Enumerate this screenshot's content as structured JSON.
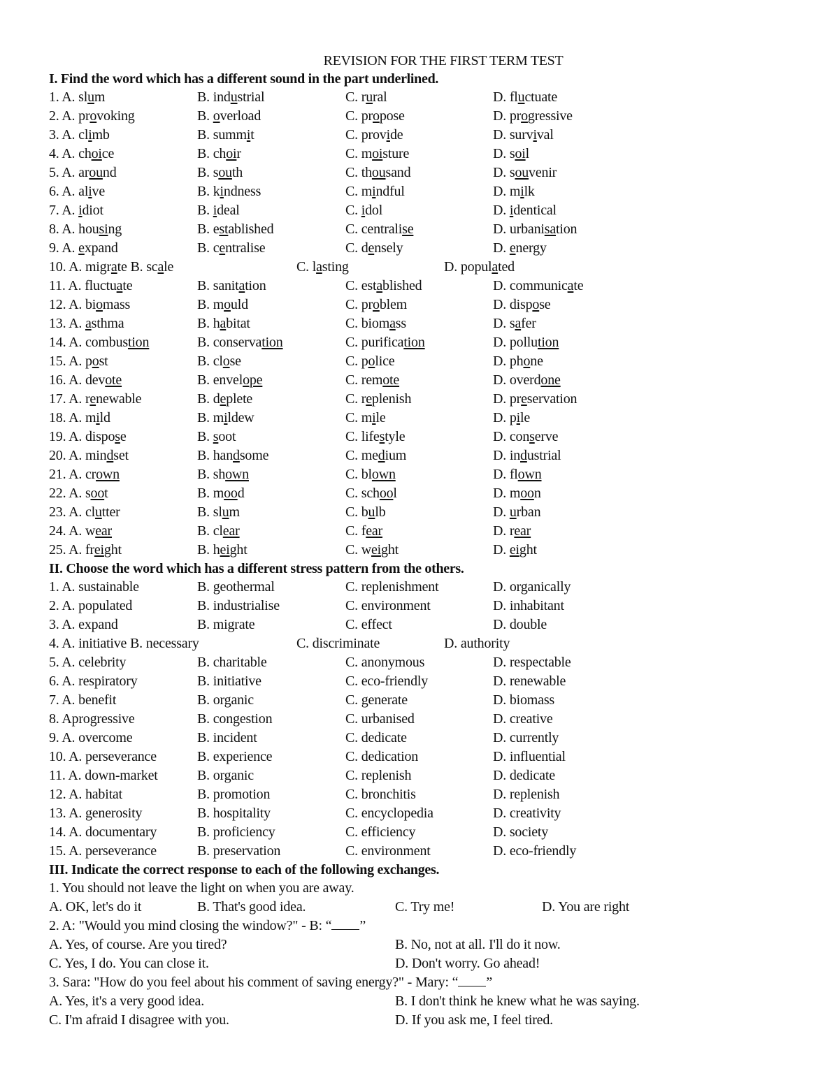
{
  "title": "REVISION FOR THE FIRST TERM TEST",
  "section1": {
    "heading": "I. Find the word which has a different sound in the part underlined.",
    "questions": [
      {
        "num": "1.",
        "options": [
          [
            "A. sl",
            "u",
            "m"
          ],
          [
            "B. ind",
            "u",
            "strial"
          ],
          [
            "C. r",
            "u",
            "ral"
          ],
          [
            "D. fl",
            "u",
            "ctuate"
          ]
        ]
      },
      {
        "num": "2.",
        "options": [
          [
            "A. pr",
            "o",
            "voking"
          ],
          [
            "B. ",
            "o",
            "verload"
          ],
          [
            "C. pr",
            "o",
            "pose"
          ],
          [
            "D. pr",
            "o",
            "gressive"
          ]
        ]
      },
      {
        "num": "3.",
        "options": [
          [
            "A. cl",
            "i",
            "mb"
          ],
          [
            "B. summ",
            "i",
            "t"
          ],
          [
            "C. prov",
            "i",
            "de"
          ],
          [
            "D. surv",
            "i",
            "val"
          ]
        ]
      },
      {
        "num": "4.",
        "options": [
          [
            "A. ch",
            "oi",
            "ce"
          ],
          [
            "B. ch",
            "oi",
            "r"
          ],
          [
            "C. m",
            "oi",
            "sture"
          ],
          [
            "D. s",
            "oi",
            "l"
          ]
        ]
      },
      {
        "num": "5.",
        "options": [
          [
            "A. ar",
            "ou",
            "nd"
          ],
          [
            "B. s",
            "ou",
            "th"
          ],
          [
            "C. th",
            "ou",
            "sand"
          ],
          [
            "D. s",
            "ou",
            "venir"
          ]
        ]
      },
      {
        "num": "6.",
        "options": [
          [
            "A. al",
            "i",
            "ve"
          ],
          [
            "B. k",
            "i",
            "ndness"
          ],
          [
            "C. m",
            "i",
            "ndful"
          ],
          [
            "D. m",
            "i",
            "lk"
          ]
        ]
      },
      {
        "num": "7.",
        "options": [
          [
            "A. ",
            "i",
            "diot"
          ],
          [
            "B. ",
            "i",
            "deal"
          ],
          [
            "C. ",
            "i",
            "dol"
          ],
          [
            "D. ",
            "i",
            "dentical"
          ]
        ]
      },
      {
        "num": "8.",
        "options": [
          [
            "A. hou",
            "si",
            "ng"
          ],
          [
            "B. e",
            "st",
            "ablished"
          ],
          [
            "C. centrali",
            "se",
            ""
          ],
          [
            "D. urbani",
            "sa",
            "tion"
          ]
        ]
      },
      {
        "num": "9.",
        "options": [
          [
            "A. ",
            "e",
            "xpand"
          ],
          [
            "B. c",
            "e",
            "ntralise"
          ],
          [
            "C. d",
            "e",
            "nsely"
          ],
          [
            "D. ",
            "e",
            "nergy"
          ]
        ]
      },
      {
        "num": "10.",
        "narrow": true,
        "options": [
          [
            "A. migr",
            "a",
            "te"
          ],
          [
            "B. sc",
            "a",
            "le"
          ],
          [
            "C. l",
            "a",
            "sting"
          ],
          [
            "D. popul",
            "a",
            "ted"
          ]
        ]
      },
      {
        "num": "11.",
        "options": [
          [
            "A. fluctu",
            "a",
            "te"
          ],
          [
            "B. sanit",
            "a",
            "tion"
          ],
          [
            "C. est",
            "a",
            "blished"
          ],
          [
            "D. communic",
            "a",
            "te"
          ]
        ]
      },
      {
        "num": "12.",
        "options": [
          [
            "A. bi",
            "o",
            "mass"
          ],
          [
            "B. m",
            "o",
            "uld"
          ],
          [
            "C. pr",
            "o",
            "blem"
          ],
          [
            "D. disp",
            "o",
            "se"
          ]
        ]
      },
      {
        "num": "13.",
        "options": [
          [
            "A. ",
            "a",
            "sthma"
          ],
          [
            "B. h",
            "a",
            "bitat"
          ],
          [
            "C. biom",
            "a",
            "ss"
          ],
          [
            "D. s",
            "a",
            "fer"
          ]
        ]
      },
      {
        "num": "14.",
        "options": [
          [
            "A. combus",
            "tion",
            ""
          ],
          [
            "B. conserva",
            "tion",
            ""
          ],
          [
            "C. purifica",
            "tion",
            ""
          ],
          [
            "D. pollu",
            "tion",
            ""
          ]
        ]
      },
      {
        "num": "15.",
        "options": [
          [
            "A. p",
            "o",
            "st"
          ],
          [
            "B. cl",
            "o",
            "se"
          ],
          [
            "C. p",
            "o",
            "lice"
          ],
          [
            "D. ph",
            "o",
            "ne"
          ]
        ]
      },
      {
        "num": "16.",
        "options": [
          [
            "A. dev",
            "ote",
            ""
          ],
          [
            "B. envel",
            "ope",
            ""
          ],
          [
            "C. rem",
            "ote",
            ""
          ],
          [
            "D. overd",
            "one",
            ""
          ]
        ]
      },
      {
        "num": "17.",
        "options": [
          [
            "A. r",
            "e",
            "newable"
          ],
          [
            "B. d",
            "e",
            "plete"
          ],
          [
            "C. r",
            "e",
            "plenish"
          ],
          [
            "D. pr",
            "e",
            "servation"
          ]
        ]
      },
      {
        "num": "18.",
        "options": [
          [
            "A. m",
            "i",
            "ld"
          ],
          [
            "B. m",
            "i",
            "ldew"
          ],
          [
            "C. m",
            "i",
            "le"
          ],
          [
            "D. p",
            "i",
            "le"
          ]
        ]
      },
      {
        "num": "19.",
        "options": [
          [
            "A. dispo",
            "s",
            "e"
          ],
          [
            "B. ",
            "s",
            "oot"
          ],
          [
            "C. life",
            "s",
            "tyle"
          ],
          [
            "D. con",
            "s",
            "erve"
          ]
        ]
      },
      {
        "num": "20.",
        "options": [
          [
            "A. min",
            "d",
            "set"
          ],
          [
            "B. han",
            "d",
            "some"
          ],
          [
            "C. me",
            "d",
            "ium"
          ],
          [
            "D. in",
            "d",
            "ustrial"
          ]
        ]
      },
      {
        "num": "21.",
        "options": [
          [
            "A. cr",
            "own",
            ""
          ],
          [
            "B. sh",
            "own",
            ""
          ],
          [
            "C. bl",
            "own",
            ""
          ],
          [
            "D. fl",
            "own",
            ""
          ]
        ]
      },
      {
        "num": "22.",
        "options": [
          [
            "A. s",
            "oo",
            "t"
          ],
          [
            "B. m",
            "oo",
            "d"
          ],
          [
            "C. sch",
            "oo",
            "l"
          ],
          [
            "D. m",
            "oo",
            "n"
          ]
        ]
      },
      {
        "num": "23.",
        "options": [
          [
            "A. cl",
            "u",
            "tter"
          ],
          [
            "B. sl",
            "u",
            "m"
          ],
          [
            "C. b",
            "u",
            "lb"
          ],
          [
            "D. ",
            "u",
            "rban"
          ]
        ]
      },
      {
        "num": "24.",
        "options": [
          [
            "A. w",
            "ear",
            ""
          ],
          [
            "B. cl",
            "ear",
            ""
          ],
          [
            "C. f",
            "ear",
            ""
          ],
          [
            "D. r",
            "ear",
            ""
          ]
        ]
      },
      {
        "num": "25.",
        "options": [
          [
            "A. fr",
            "ei",
            "ght"
          ],
          [
            "B. h",
            "ei",
            "ght"
          ],
          [
            "C. w",
            "ei",
            "ght"
          ],
          [
            "D. ",
            "ei",
            "ght"
          ]
        ]
      }
    ]
  },
  "section2": {
    "heading": "II. Choose the word which has a different stress pattern from the others.",
    "questions": [
      {
        "num": "1.",
        "options": [
          "A. sustainable",
          "B. geothermal",
          "C. replenishment",
          "D. organically"
        ]
      },
      {
        "num": "2.",
        "options": [
          "A. populated",
          "B. industrialise",
          "C. environment",
          "D. inhabitant"
        ]
      },
      {
        "num": "3.",
        "options": [
          "A. expand",
          "B. migrate",
          "C. effect",
          "D. double"
        ]
      },
      {
        "num": "4.",
        "narrow": true,
        "options": [
          "A. initiative",
          "B. necessary",
          "C. discriminate",
          "D. authority"
        ]
      },
      {
        "num": "5.",
        "options": [
          "A. celebrity",
          "B. charitable",
          "C. anonymous",
          "D. respectable"
        ]
      },
      {
        "num": "6.",
        "options": [
          "A. respiratory",
          "B. initiative",
          "C. eco-friendly",
          "D. renewable"
        ]
      },
      {
        "num": "7.",
        "options": [
          "A. benefit",
          "B. organic",
          "C. generate",
          "D. biomass"
        ]
      },
      {
        "num": "8.",
        "options": [
          "Aprogressive",
          "B. congestion",
          "C. urbanised",
          "D. creative"
        ]
      },
      {
        "num": "9.",
        "options": [
          "A. overcome",
          "B. incident",
          "C. dedicate",
          "D. currently"
        ]
      },
      {
        "num": "10.",
        "options": [
          "A. perseverance",
          "B. experience",
          "C. dedication",
          "D. influential"
        ]
      },
      {
        "num": "11.",
        "options": [
          "A. down-market",
          "B. organic",
          "C. replenish",
          "D. dedicate"
        ]
      },
      {
        "num": "12.",
        "options": [
          "A. habitat",
          "B. promotion",
          "C. bronchitis",
          "D. replenish"
        ]
      },
      {
        "num": "13.",
        "options": [
          "A. generosity",
          "B. hospitality",
          "C. encyclopedia",
          "D. creativity"
        ]
      },
      {
        "num": "14.",
        "options": [
          "A. documentary",
          "B. proficiency",
          "C. efficiency",
          "D. society"
        ]
      },
      {
        "num": "15.",
        "options": [
          "A. perseverance",
          "B. preservation",
          "C. environment",
          "D. eco-friendly"
        ]
      }
    ]
  },
  "section3": {
    "heading": "III. Indicate the correct response to each of the following exchanges.",
    "q1": {
      "prompt": "1. You should not leave the light on when you are away.",
      "options": [
        "A. OK, let's do it",
        "B. That's good idea.",
        "C. Try me!",
        "D. You are right"
      ]
    },
    "q2": {
      "prompt_pre": "2. A: \"Would you mind closing the window?\" - B: “",
      "prompt_post": "”",
      "options": [
        "A. Yes, of course. Are you tired?",
        "B. No, not at all. I'll do it now.",
        "C. Yes, I do. You can close it.",
        "D. Don't worry. Go ahead!"
      ]
    },
    "q3": {
      "prompt_pre": "3. Sara: \"How do you feel about his comment of saving energy?\" - Mary: “",
      "prompt_post": "”",
      "options": [
        "A. Yes, it's a very good idea.",
        "B. I don't think he knew what he was saying.",
        "C. I'm afraid I disagree with you.",
        "D. If you ask me, I feel tired."
      ]
    }
  }
}
